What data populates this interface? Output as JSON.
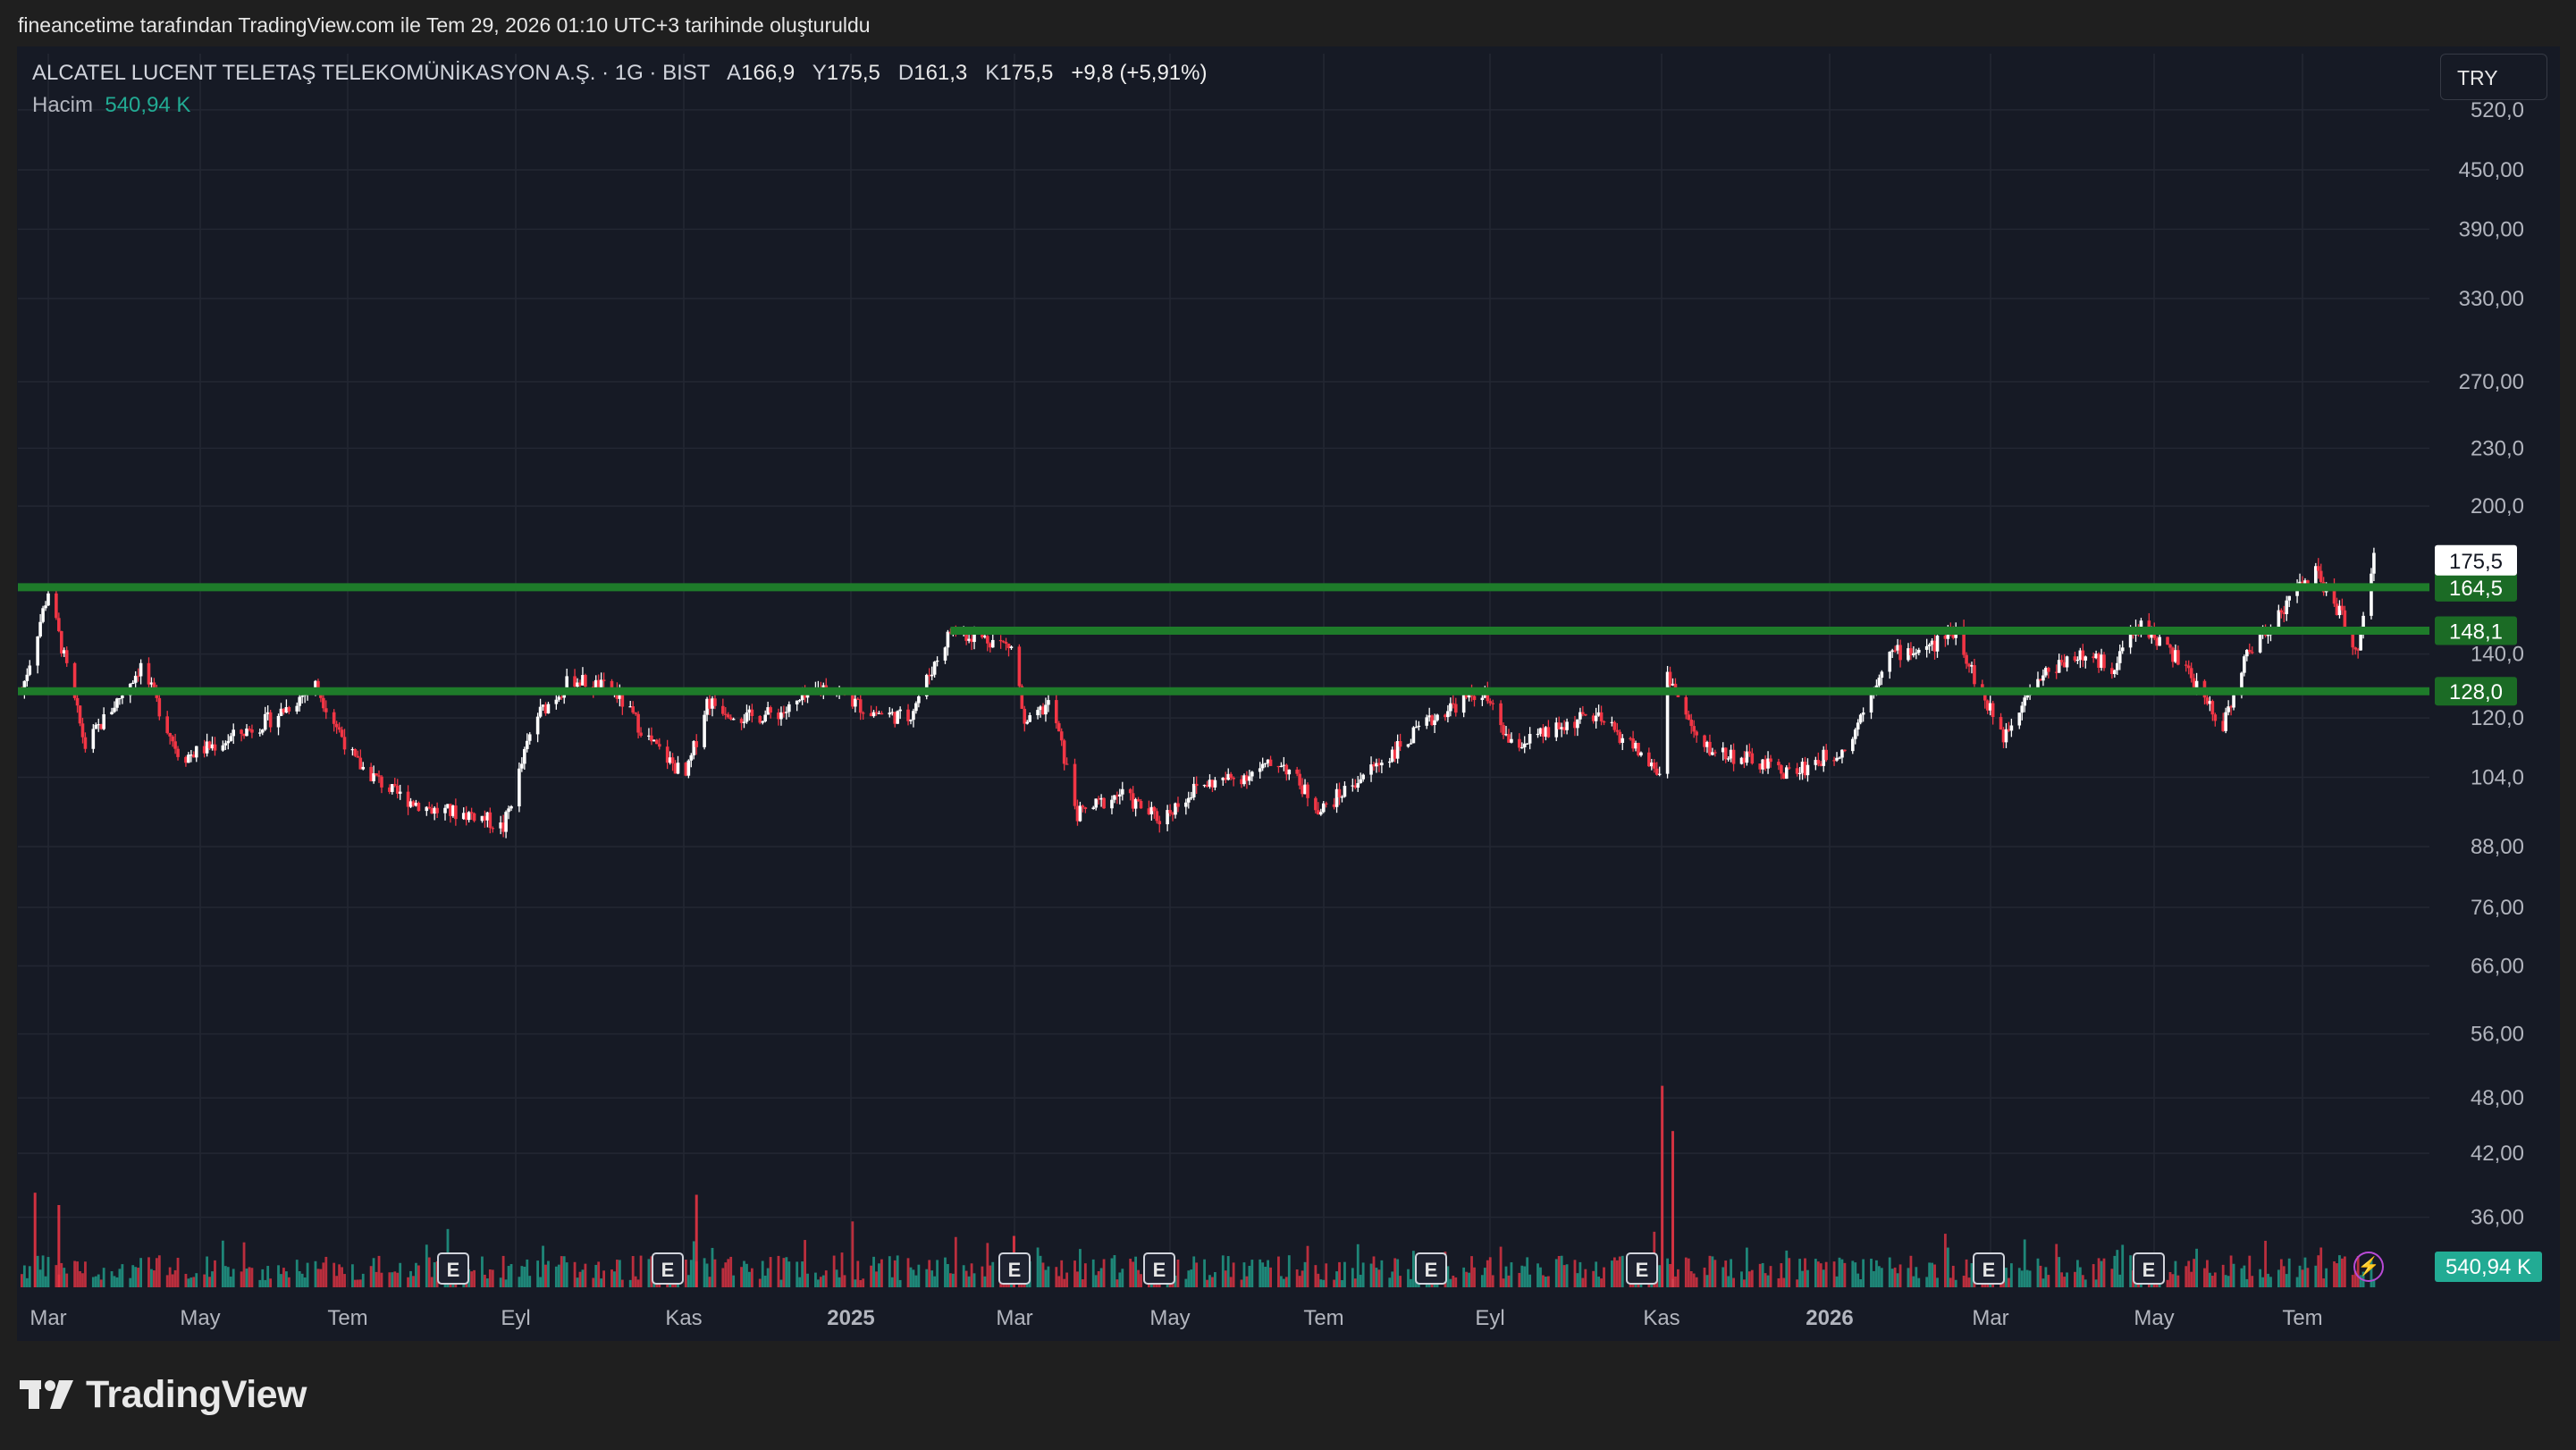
{
  "header": {
    "caption": "fineancetime tarafından TradingView.com ile Tem 29, 2026 01:10 UTC+3 tarihinde oluşturuldu"
  },
  "legend": {
    "symbol": "ALCATEL LUCENT TELETAŞ TELEKOMÜNİKASYON A.Ş. · 1G · BIST",
    "open_label": "A",
    "open": "166,9",
    "high_label": "Y",
    "high": "175,5",
    "low_label": "D",
    "low": "161,3",
    "close_label": "K",
    "close": "175,5",
    "change": "+9,8 (+5,91%)",
    "volume_label": "Hacim",
    "volume_value": "540,94 K"
  },
  "currency_button": "TRY",
  "brand": "TradingView",
  "colors": {
    "up": "#ffffff",
    "down": "#f23645",
    "level": "#1e7b2a",
    "level_label": "#1b6b25",
    "volume_up": "#22ab94",
    "volume_down": "#f23645",
    "background": "#161a25",
    "grid": "#232733"
  },
  "chart_data": {
    "type": "candlestick",
    "title": "",
    "yscale": "log",
    "ylim": [
      85,
      540
    ],
    "y_ticks": [
      "520,0",
      "450,00",
      "390,00",
      "330,00",
      "270,00",
      "230,0",
      "200,0",
      "140,0",
      "120,0",
      "104,0",
      "88,00",
      "76,00",
      "66,00",
      "56,00",
      "48,00",
      "42,00",
      "36,00"
    ],
    "x_ticks": [
      "Mar",
      "May",
      "Tem",
      "Eyl",
      "Kas",
      "2025",
      "Mar",
      "May",
      "Tem",
      "Eyl",
      "Kas",
      "2026",
      "Mar",
      "May",
      "Tem"
    ],
    "x_tick_bold": [
      false,
      false,
      false,
      false,
      false,
      true,
      false,
      false,
      false,
      false,
      false,
      true,
      false,
      false,
      false
    ],
    "earnings_marker_label": "E",
    "earnings_markers": [
      "2024-08",
      "2024-11",
      "2025-03",
      "2025-05",
      "2025-08",
      "2025-11",
      "2026-02",
      "2026-05"
    ],
    "last_price_label": "175,5",
    "last_volume_label": "540,94 K",
    "horizontal_levels": [
      {
        "value": 164.5,
        "label": "164,5"
      },
      {
        "value": 148.1,
        "label": "148,1"
      },
      {
        "value": 128.0,
        "label": "128,0"
      }
    ],
    "price_path": [
      {
        "date": "2024-02-20",
        "close": 128
      },
      {
        "date": "2024-03-01",
        "close": 163
      },
      {
        "date": "2024-03-15",
        "close": 112
      },
      {
        "date": "2024-04-05",
        "close": 136
      },
      {
        "date": "2024-04-20",
        "close": 109
      },
      {
        "date": "2024-05-05",
        "close": 113
      },
      {
        "date": "2024-05-25",
        "close": 120
      },
      {
        "date": "2024-06-10",
        "close": 130
      },
      {
        "date": "2024-06-25",
        "close": 108
      },
      {
        "date": "2024-07-10",
        "close": 100
      },
      {
        "date": "2024-07-25",
        "close": 96
      },
      {
        "date": "2024-08-10",
        "close": 95
      },
      {
        "date": "2024-08-20",
        "close": 92
      },
      {
        "date": "2024-09-01",
        "close": 120
      },
      {
        "date": "2024-09-15",
        "close": 132
      },
      {
        "date": "2024-10-01",
        "close": 128
      },
      {
        "date": "2024-10-15",
        "close": 113
      },
      {
        "date": "2024-10-28",
        "close": 104
      },
      {
        "date": "2024-11-05",
        "close": 125
      },
      {
        "date": "2024-11-20",
        "close": 120
      },
      {
        "date": "2024-12-05",
        "close": 122
      },
      {
        "date": "2024-12-20",
        "close": 130
      },
      {
        "date": "2025-01-05",
        "close": 122
      },
      {
        "date": "2025-01-20",
        "close": 120
      },
      {
        "date": "2025-02-05",
        "close": 148
      },
      {
        "date": "2025-02-20",
        "close": 145
      },
      {
        "date": "2025-03-01",
        "close": 142
      },
      {
        "date": "2025-03-05",
        "close": 117
      },
      {
        "date": "2025-03-15",
        "close": 125
      },
      {
        "date": "2025-03-25",
        "close": 95
      },
      {
        "date": "2025-04-10",
        "close": 100
      },
      {
        "date": "2025-04-25",
        "close": 94
      },
      {
        "date": "2025-05-10",
        "close": 102
      },
      {
        "date": "2025-05-25",
        "close": 104
      },
      {
        "date": "2025-06-10",
        "close": 108
      },
      {
        "date": "2025-06-25",
        "close": 96
      },
      {
        "date": "2025-07-10",
        "close": 104
      },
      {
        "date": "2025-07-25",
        "close": 112
      },
      {
        "date": "2025-08-10",
        "close": 122
      },
      {
        "date": "2025-08-25",
        "close": 128
      },
      {
        "date": "2025-09-05",
        "close": 112
      },
      {
        "date": "2025-09-20",
        "close": 116
      },
      {
        "date": "2025-10-05",
        "close": 121
      },
      {
        "date": "2025-10-20",
        "close": 113
      },
      {
        "date": "2025-11-01",
        "close": 104
      },
      {
        "date": "2025-11-03",
        "close": 134
      },
      {
        "date": "2025-11-15",
        "close": 112
      },
      {
        "date": "2025-12-01",
        "close": 109
      },
      {
        "date": "2025-12-20",
        "close": 105
      },
      {
        "date": "2026-01-10",
        "close": 112
      },
      {
        "date": "2026-01-25",
        "close": 140
      },
      {
        "date": "2026-02-10",
        "close": 142
      },
      {
        "date": "2026-02-20",
        "close": 149
      },
      {
        "date": "2026-03-01",
        "close": 128
      },
      {
        "date": "2026-03-10",
        "close": 115
      },
      {
        "date": "2026-03-20",
        "close": 130
      },
      {
        "date": "2026-04-05",
        "close": 140
      },
      {
        "date": "2026-04-20",
        "close": 136
      },
      {
        "date": "2026-05-01",
        "close": 151
      },
      {
        "date": "2026-05-15",
        "close": 138
      },
      {
        "date": "2026-05-25",
        "close": 126
      },
      {
        "date": "2026-06-01",
        "close": 118
      },
      {
        "date": "2026-06-10",
        "close": 140
      },
      {
        "date": "2026-06-25",
        "close": 158
      },
      {
        "date": "2026-07-05",
        "close": 172
      },
      {
        "date": "2026-07-15",
        "close": 155
      },
      {
        "date": "2026-07-22",
        "close": 140
      },
      {
        "date": "2026-07-28",
        "close": 175.5
      }
    ],
    "volume_spikes": [
      {
        "date": "2024-02-25",
        "value": 4.6
      },
      {
        "date": "2024-03-05",
        "value": 4.0
      },
      {
        "date": "2024-11-01",
        "value": 4.5
      },
      {
        "date": "2025-03-01",
        "value": 2.5
      },
      {
        "date": "2025-11-01",
        "value": 9.8
      },
      {
        "date": "2025-11-05",
        "value": 7.6
      }
    ]
  }
}
